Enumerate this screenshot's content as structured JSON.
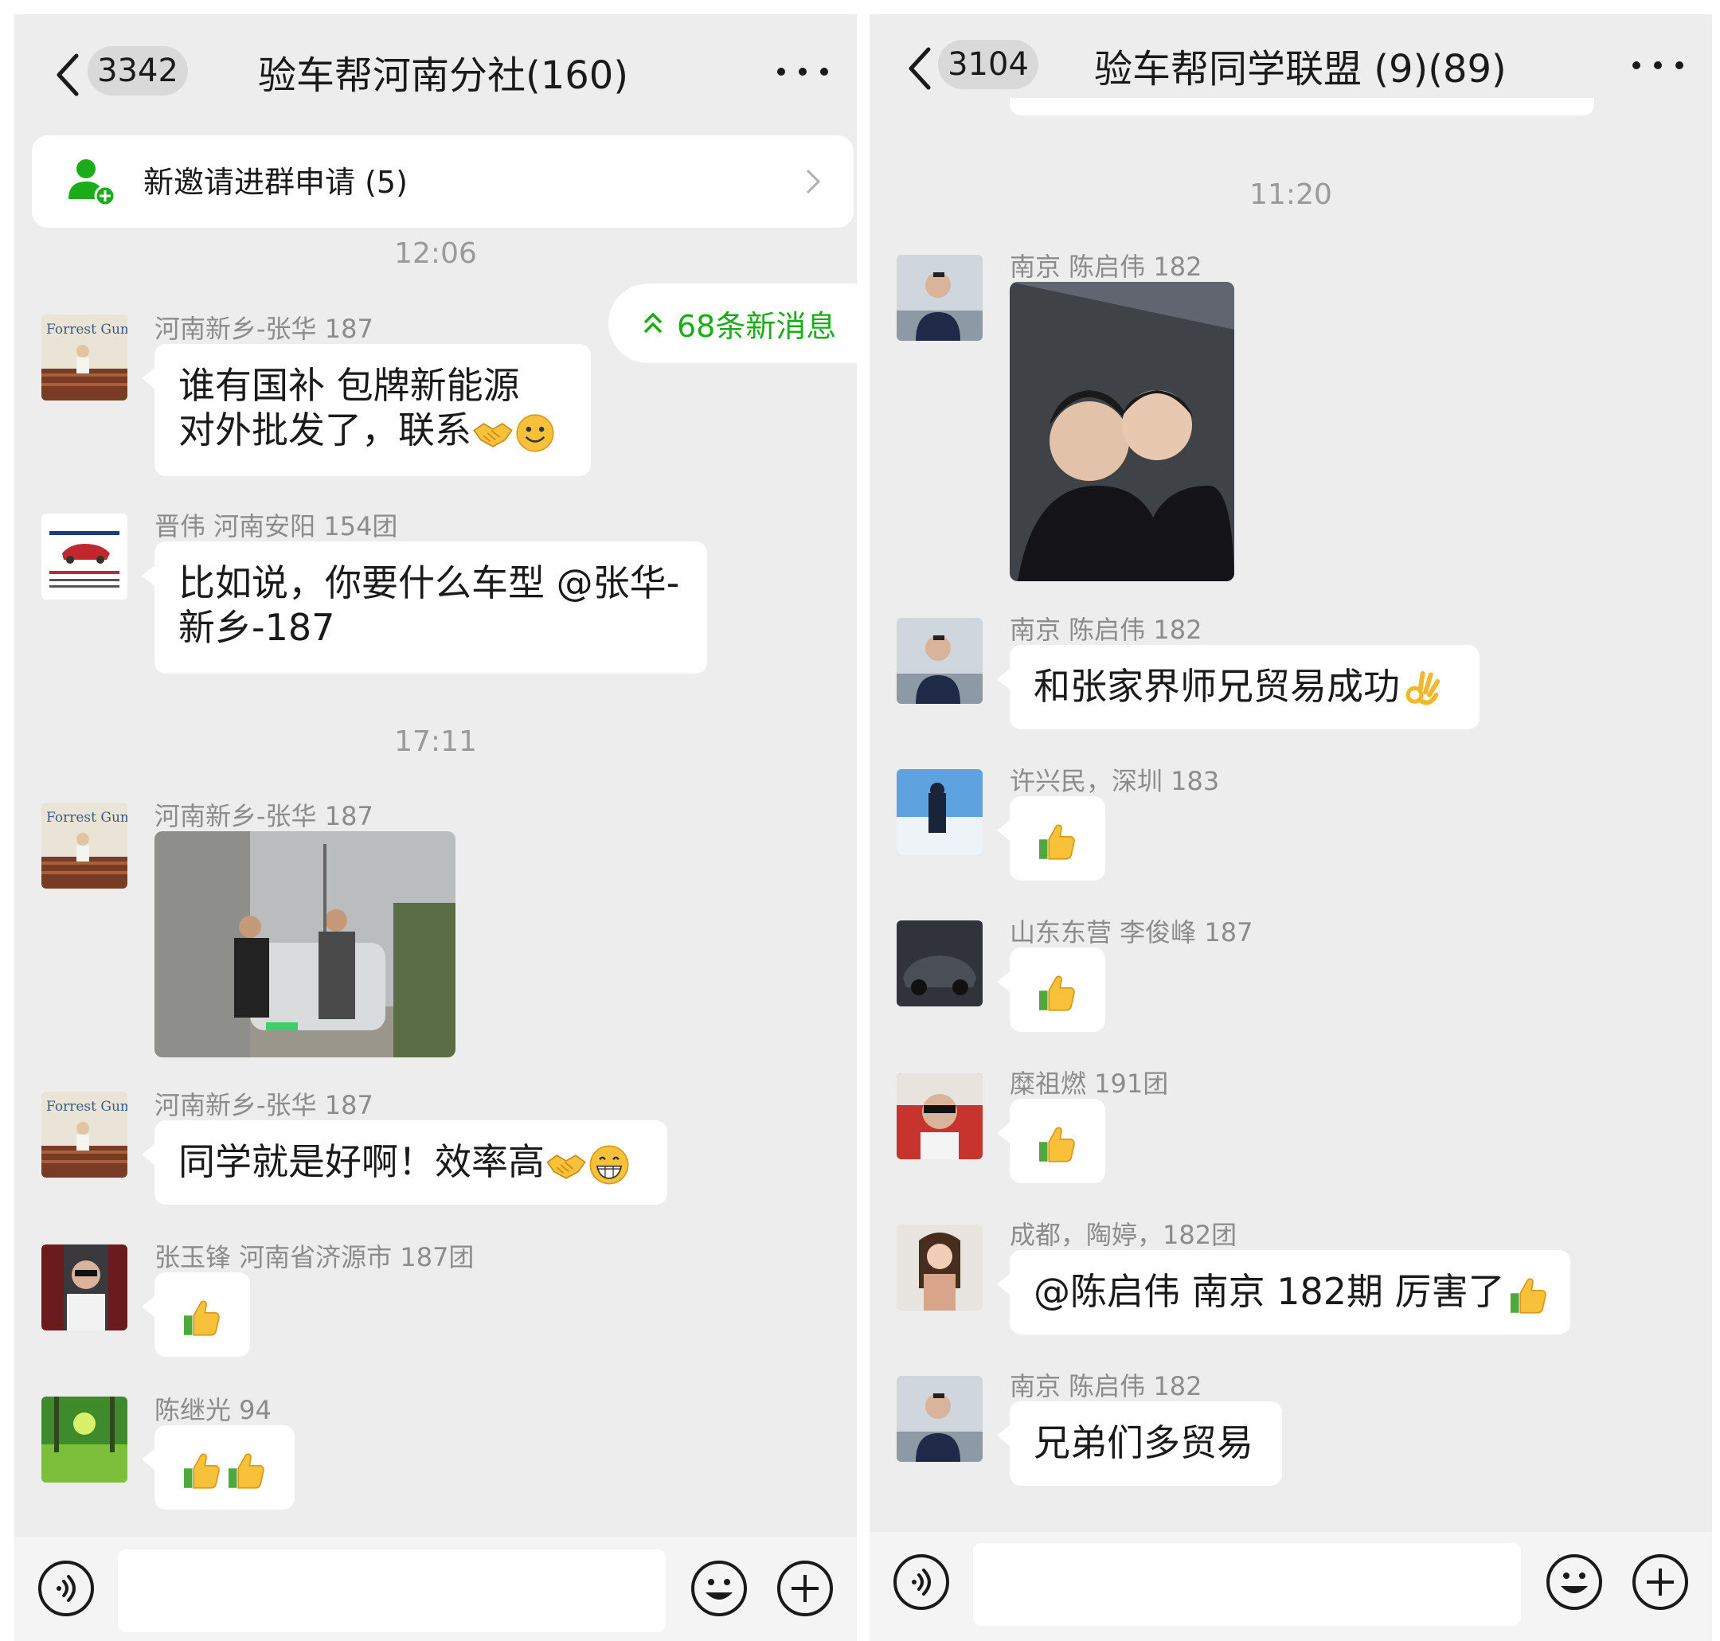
{
  "left": {
    "header": {
      "back_count": "3342",
      "title": "验车帮河南分社(160)"
    },
    "invite_bar": {
      "label": "新邀请进群申请 (5)"
    },
    "new_messages": "68条新消息",
    "times": [
      "12:06",
      "17:11"
    ],
    "messages": [
      {
        "sender": "河南新乡-张华 187",
        "lines": [
          "谁有国补 包牌新能源",
          "对外批发了，联系"
        ]
      },
      {
        "sender": "晋伟  河南安阳 154团",
        "lines": [
          "比如说，你要什么车型 @张华-",
          "新乡-187"
        ]
      },
      {
        "sender": "河南新乡-张华 187",
        "photo": "handshake-photo"
      },
      {
        "sender": "河南新乡-张华 187",
        "lines": [
          "同学就是好啊！效率高"
        ]
      },
      {
        "sender": "张玉锋 河南省济源市 187团"
      },
      {
        "sender": "陈继光 94"
      }
    ],
    "avatar_texts": {
      "forrest_gump": "Forrest Gump"
    }
  },
  "right": {
    "header": {
      "back_count": "3104",
      "title": "验车帮同学联盟 (9)(89)"
    },
    "times": [
      "11:20"
    ],
    "messages": [
      {
        "sender": "南京 陈启伟 182",
        "photo": "selfie-photo"
      },
      {
        "sender": "南京 陈启伟 182",
        "lines": [
          "和张家界师兄贸易成功"
        ]
      },
      {
        "sender": "许兴民，深圳 183"
      },
      {
        "sender": "山东东营 李俊峰 187"
      },
      {
        "sender": "糜祖燃 191团"
      },
      {
        "sender": "成都，陶婷，182团",
        "lines": [
          "@陈启伟 南京 182期 厉害了"
        ]
      },
      {
        "sender": "南京 陈启伟 182",
        "lines": [
          "兄弟们多贸易"
        ]
      }
    ]
  },
  "colors": {
    "accent_green": "#1aad19",
    "background": "#ededed",
    "bubble": "#ffffff"
  }
}
